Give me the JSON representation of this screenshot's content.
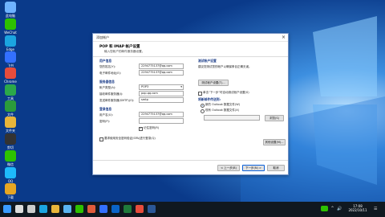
{
  "colors": {
    "accent": "#0a5fd8",
    "section": "#1e3f8a",
    "taskbar": "#101820"
  },
  "desktop": {
    "icons": [
      {
        "label": "此电脑",
        "icon": "computer-icon",
        "color": "#6fb3ff"
      },
      {
        "label": "WeChat",
        "icon": "wechat-icon",
        "color": "#2dc100"
      },
      {
        "label": "Edge",
        "icon": "edge-icon",
        "color": "#1ba5e0"
      },
      {
        "label": "飞书",
        "icon": "feishu-icon",
        "color": "#3370ff"
      },
      {
        "label": "Chrome",
        "icon": "chrome-icon",
        "color": "#e74c3c"
      },
      {
        "label": "工具",
        "icon": "tool-icon",
        "color": "#2ba84a"
      },
      {
        "label": "文件",
        "icon": "file-icon",
        "color": "#2b9b3b"
      },
      {
        "label": "文件夹",
        "icon": "folder-icon",
        "color": "#e8b53a"
      },
      {
        "label": "剪切",
        "icon": "scissors-icon",
        "color": "#333333"
      },
      {
        "label": "微信",
        "icon": "wechat-icon",
        "color": "#2dc100"
      },
      {
        "label": "QQ",
        "icon": "qq-icon",
        "color": "#1ebafc"
      },
      {
        "label": "下载",
        "icon": "download-icon",
        "color": "#e6a623"
      }
    ]
  },
  "dialog": {
    "title": "添加帐户",
    "close": "×",
    "header_title": "POP 和 IMAP 帐户设置",
    "header_sub": "输入您帐户的邮件服务器设置。",
    "user_info": {
      "heading": "用户信息",
      "name_label": "您的姓名(Y):",
      "name_value": "2294775137@qq.com",
      "email_label": "电子邮件地址(E):",
      "email_value": "2294775137@qq.com"
    },
    "server_info": {
      "heading": "服务器信息",
      "type_label": "帐户类型(A):",
      "type_value": "POP3",
      "incoming_label": "接收邮件服务器(I):",
      "incoming_value": "pop.qq.com",
      "outgoing_label": "发送邮件服务器(SMTP)(O):",
      "outgoing_value": "smtp"
    },
    "logon_info": {
      "heading": "登录信息",
      "user_label": "用户名(U):",
      "user_value": "2294775137@qq.com",
      "password_label": "密码(P):",
      "password_value": "",
      "remember_label": "记住密码(R)",
      "spa_label": "要求使用安全密码验证(SPA)进行登录(Q)"
    },
    "test": {
      "heading": "测试帐户设置",
      "desc1": "建议您测试您的帐户以确保条目正确无误。",
      "test_button": "测试帐户设置(T)...",
      "auto_test_label": "单击“下一步”时自动测试帐户设置(S)",
      "deliver_heading": "将新邮件传送到:",
      "new_pst_label": "新的 Outlook 数据文件(W)",
      "existing_pst_label": "现有 Outlook 数据文件(X)",
      "browse_button": "浏览(S)",
      "more_settings": "其他设置(M)..."
    },
    "footer": {
      "back": "< 上一步(B)",
      "next": "下一步(N) >",
      "cancel": "取消"
    }
  },
  "taskbar": {
    "apps": [
      {
        "icon": "windows-start-icon",
        "color": "#3a9bff"
      },
      {
        "icon": "search-icon",
        "color": "#dddddd"
      },
      {
        "icon": "task-view-icon",
        "color": "#cccccc"
      },
      {
        "icon": "edge-icon",
        "color": "#1ba5e0"
      },
      {
        "icon": "folder-icon",
        "color": "#e8b53a"
      },
      {
        "icon": "store-icon",
        "color": "#5ab3f0"
      },
      {
        "icon": "wechat-icon",
        "color": "#2dc100"
      },
      {
        "icon": "video-icon",
        "color": "#e05b3b"
      },
      {
        "icon": "feishu-icon",
        "color": "#3370ff"
      },
      {
        "icon": "outlook-icon",
        "color": "#0a64c8"
      },
      {
        "icon": "excel-icon",
        "color": "#1f7a3b"
      },
      {
        "icon": "chrome-icon",
        "color": "#e74c3c"
      },
      {
        "icon": "word-icon",
        "color": "#2b5797"
      }
    ],
    "time": "17:08",
    "date": "2022/10/11"
  }
}
